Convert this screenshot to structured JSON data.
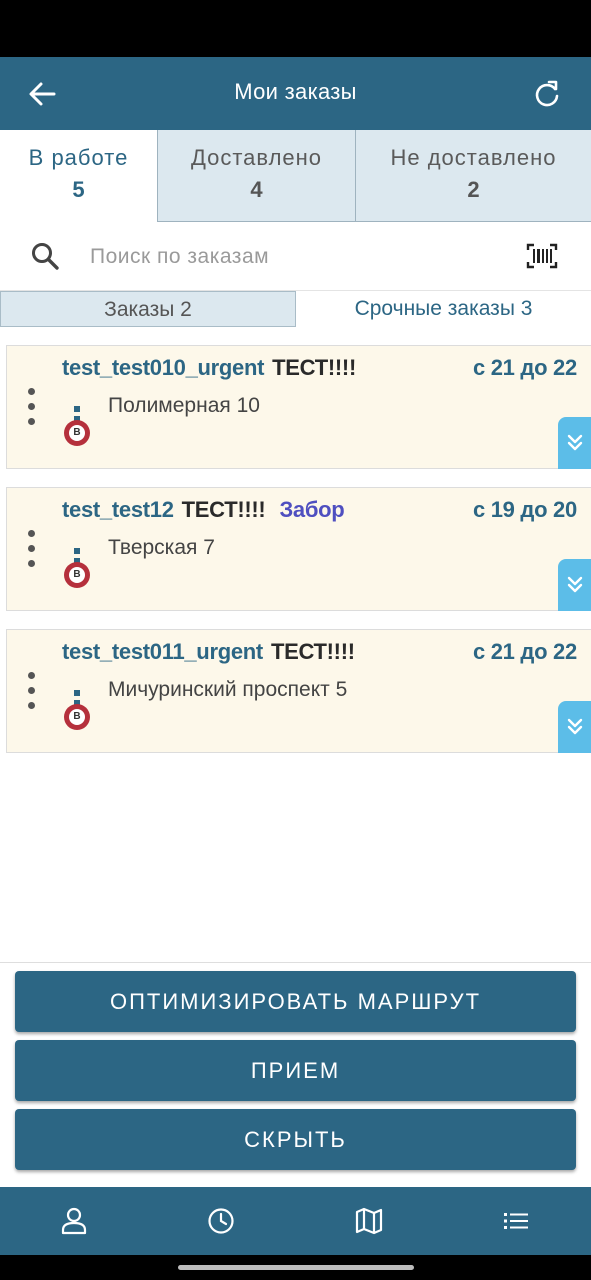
{
  "app_bar": {
    "title": "Мои заказы",
    "back_icon": "arrow-left-icon",
    "refresh_icon": "refresh-icon"
  },
  "status_tabs": [
    {
      "label": "В работе",
      "count": "5"
    },
    {
      "label": "Доставлено",
      "count": "4"
    },
    {
      "label": "Не доставлено",
      "count": "2"
    }
  ],
  "search": {
    "placeholder": "Поиск по заказам",
    "value": "",
    "icon": "search-icon",
    "scan_icon": "barcode-icon"
  },
  "sub_tabs": [
    {
      "label": "Заказы 2"
    },
    {
      "label": "Срочные заказы 3"
    }
  ],
  "orders": [
    {
      "number": "test_test010_urgent",
      "name": "ТЕСТ!!!!",
      "tag": "",
      "time": "с 21 до 22",
      "address": "Полимерная 10",
      "badge": "B"
    },
    {
      "number": "test_test12",
      "name": "ТЕСТ!!!!",
      "tag": "Забор",
      "time": "с 19 до 20",
      "address": "Тверская 7",
      "badge": "B"
    },
    {
      "number": "test_test011_urgent",
      "name": "ТЕСТ!!!!",
      "tag": "",
      "time": "с 21 до 22",
      "address": "Мичуринский проспект 5",
      "badge": "B"
    }
  ],
  "actions": {
    "optimize": "ОПТИМИЗИРОВАТЬ МАРШРУТ",
    "receive": "ПРИЕМ",
    "hide": "СКРЫТЬ"
  },
  "bottom_nav": [
    {
      "icon": "profile-icon"
    },
    {
      "icon": "clock-icon"
    },
    {
      "icon": "map-icon"
    },
    {
      "icon": "list-icon"
    }
  ],
  "colors": {
    "primary": "#2c6684",
    "card_bg": "#fdf8ea",
    "tab_inactive": "#dce8ef",
    "expand": "#5cbde8",
    "badge": "#b5303c",
    "tag": "#4f4fc0"
  }
}
